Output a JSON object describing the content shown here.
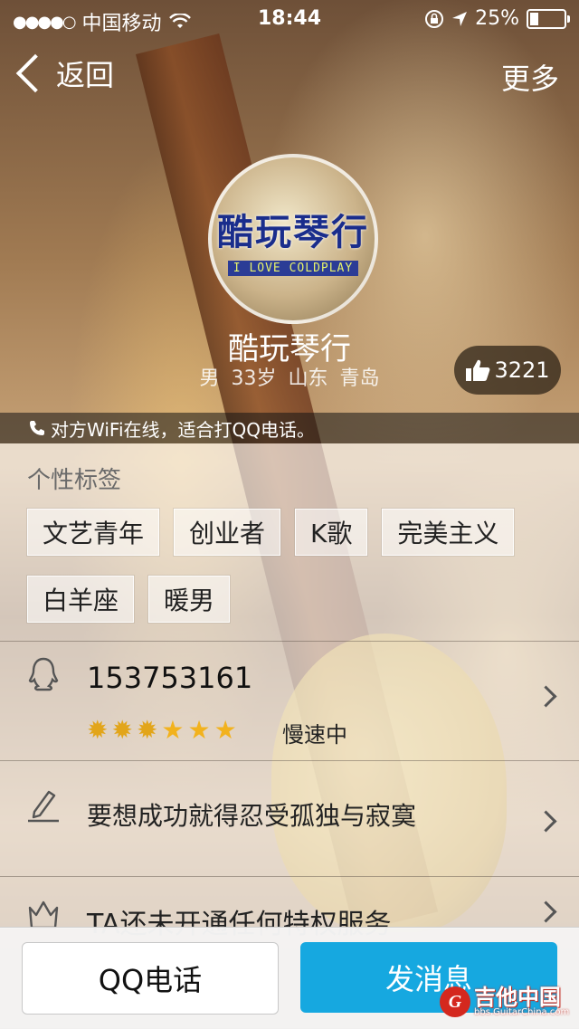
{
  "status_bar": {
    "signal": "●●●●○",
    "carrier": "中国移动",
    "time": "18:44",
    "battery": "25%",
    "battery_level": 0.25
  },
  "nav": {
    "back_label": "返回",
    "more_label": "更多"
  },
  "profile": {
    "avatar_title": "酷玩琴行",
    "avatar_subtitle": "I LOVE COLDPLAY",
    "name": "酷玩琴行",
    "info": "男 33岁 山东 青岛",
    "likes": "3221"
  },
  "wifi_notice": "对方WiFi在线，适合打QQ电话。",
  "tags_section": {
    "title": "个性标签",
    "row1": [
      "文艺青年",
      "创业者",
      "K歌",
      "完美主义"
    ],
    "row2": [
      "白羊座",
      "暖男"
    ]
  },
  "qq_row": {
    "number": "153753161",
    "level": {
      "suns": 3,
      "stars": 3
    },
    "speed": "慢速中"
  },
  "signature_row": {
    "text": "要想成功就得忍受孤独与寂寞"
  },
  "privilege_row": {
    "text": "TA还未开通任何特权服务"
  },
  "bottom": {
    "call_label": "QQ电话",
    "message_label": "发消息"
  },
  "watermark": {
    "logo": "G",
    "main": "吉他中国",
    "sub": "bbs.GuitarChina.com"
  },
  "colors": {
    "accent": "#16a8e0",
    "watermark_red": "#d4281e"
  }
}
